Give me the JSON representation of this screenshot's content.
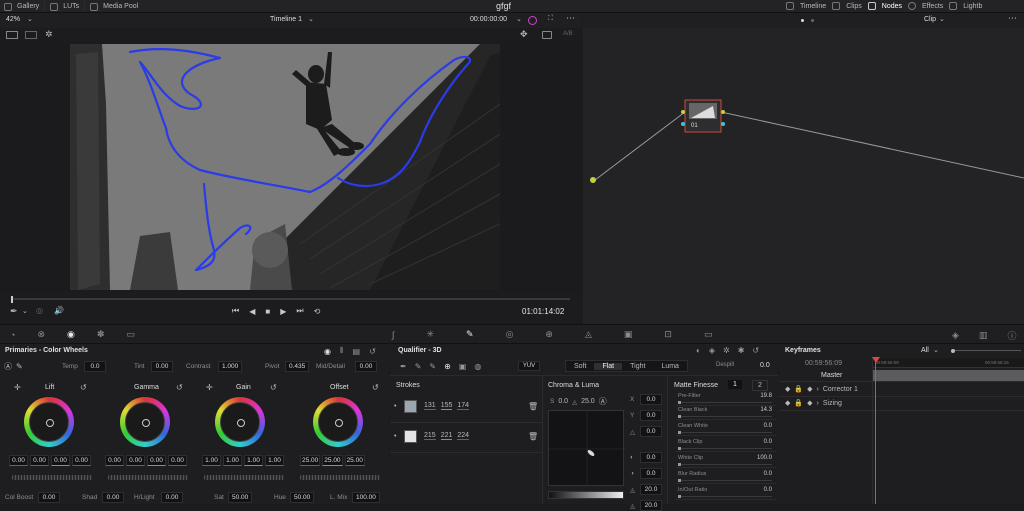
{
  "topbar": {
    "left_tabs": [
      "Gallery",
      "LUTs",
      "Media Pool"
    ],
    "project_title": "gfgf",
    "right_tabs": [
      "Timeline",
      "Clips",
      "Nodes",
      "Effects",
      "Lightb"
    ]
  },
  "viewer": {
    "zoom": "42%",
    "timeline_name": "Timeline 1",
    "timecode_top": "00:00:00:00",
    "timecode_current": "01:01:14:02",
    "ab_label": "A/B"
  },
  "nodes": {
    "mode": "Clip",
    "node_label": "01"
  },
  "primaries": {
    "title": "Primaries - Color Wheels",
    "temp_label": "Temp",
    "temp_value": "0.0",
    "tint_label": "Tint",
    "tint_value": "0.00",
    "contrast_label": "Contrast",
    "contrast_value": "1.000",
    "pivot_label": "Pivot",
    "pivot_value": "0.435",
    "middetail_label": "Mid/Detail",
    "middetail_value": "0.00",
    "wheels": [
      {
        "name": "Lift",
        "values": [
          "0.00",
          "0.00",
          "0.00",
          "0.00"
        ]
      },
      {
        "name": "Gamma",
        "values": [
          "0.00",
          "0.00",
          "0.00",
          "0.00"
        ]
      },
      {
        "name": "Gain",
        "values": [
          "1.00",
          "1.00",
          "1.00",
          "1.00"
        ]
      },
      {
        "name": "Offset",
        "values": [
          "25.00",
          "25.00",
          "25.00"
        ]
      }
    ],
    "colboost_label": "Col Boost",
    "colboost_value": "0.00",
    "shad_label": "Shad",
    "shad_value": "0.00",
    "hlight_label": "H/Light",
    "hlight_value": "0.00",
    "sat_label": "Sat",
    "sat_value": "50.00",
    "hue_label": "Hue",
    "hue_value": "50.00",
    "lmix_label": "L. Mix",
    "lmix_value": "100.00"
  },
  "qualifier": {
    "title": "Qualifier - 3D",
    "colorspace": "YUV",
    "modes": [
      "Soft",
      "Flat",
      "Tight",
      "Luma"
    ],
    "despill_label": "Despill",
    "despill_value": "0.0",
    "strokes_label": "Strokes",
    "strokes": [
      {
        "values": [
          "131",
          "155",
          "174"
        ],
        "color": "#9aa6b0"
      },
      {
        "values": [
          "215",
          "221",
          "224"
        ],
        "color": "#e2e4e6"
      }
    ],
    "chroma_luma_label": "Chroma & Luma",
    "cl_values": [
      "0.0",
      "25.0"
    ],
    "xy_labels": [
      "X",
      "Y"
    ],
    "xy_values": [
      "0.0",
      "0.0"
    ],
    "side_values": [
      "0.0",
      "0.0",
      "0.0",
      "20.0",
      "20.0"
    ],
    "matte_finesse_label": "Matte Finesse",
    "matte_tabs": [
      "1",
      "2"
    ],
    "matte_rows": [
      {
        "label": "Pre-Filter",
        "value": "19.8"
      },
      {
        "label": "Clean Black",
        "value": "14.3"
      },
      {
        "label": "Clean White",
        "value": "0.0"
      },
      {
        "label": "Black Clip",
        "value": "0.0"
      },
      {
        "label": "White Clip",
        "value": "100.0"
      },
      {
        "label": "Blur Radius",
        "value": "0.0"
      },
      {
        "label": "In/Out Ratio",
        "value": "0.0"
      }
    ]
  },
  "keyframes": {
    "title": "Keyframes",
    "filter": "All",
    "timecode": "00:59:56:09",
    "ruler_left": "00:59:56:09",
    "ruler_right": "00:59:58:15",
    "tracks": [
      "Master",
      "Corrector 1",
      "Sizing"
    ]
  },
  "colors": {
    "accent": "#e0473f",
    "stroke": "#2a3be8",
    "highlight": "#b8b8b8"
  }
}
